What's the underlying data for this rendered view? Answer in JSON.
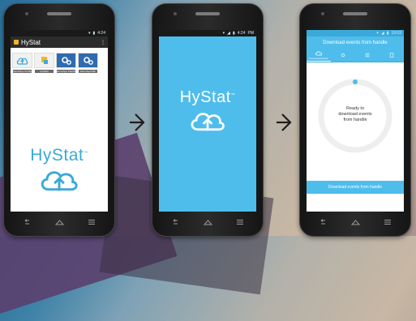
{
  "phone1": {
    "status_time": "4:24",
    "app_title": "HyStat",
    "tiles": [
      {
        "label": "HemoSys Config",
        "icon": "cloud-upload-icon",
        "color": "#3aa9da"
      },
      {
        "label": "HyStats",
        "icon": "hystat-square-icon",
        "color": "#f3b722"
      },
      {
        "label": "HemoSys Pandora/DL4",
        "icon": "gears-icon",
        "color": "#2e6bb0"
      },
      {
        "label": "HemoSys D2L",
        "icon": "gears-icon",
        "color": "#2e6bb0"
      }
    ],
    "logo_text": "HyStat",
    "logo_tm": "™",
    "logo_color": "#3aa9da"
  },
  "phone2": {
    "status_time": "4:24",
    "status_suffix": "PM",
    "logo_text": "HyStat",
    "logo_tm": "™",
    "background": "#4fbdec"
  },
  "phone3": {
    "status_time": "10:03",
    "header_title": "Download events from handle",
    "tabs": [
      {
        "label": "Download Events",
        "active": true
      },
      {
        "label": "",
        "active": false
      },
      {
        "label": "",
        "active": false
      },
      {
        "label": "",
        "active": false
      }
    ],
    "progress_lines": [
      "Ready to",
      "download events",
      "from handle"
    ],
    "button_label": "Download events from handle",
    "accent": "#4fbdec"
  }
}
